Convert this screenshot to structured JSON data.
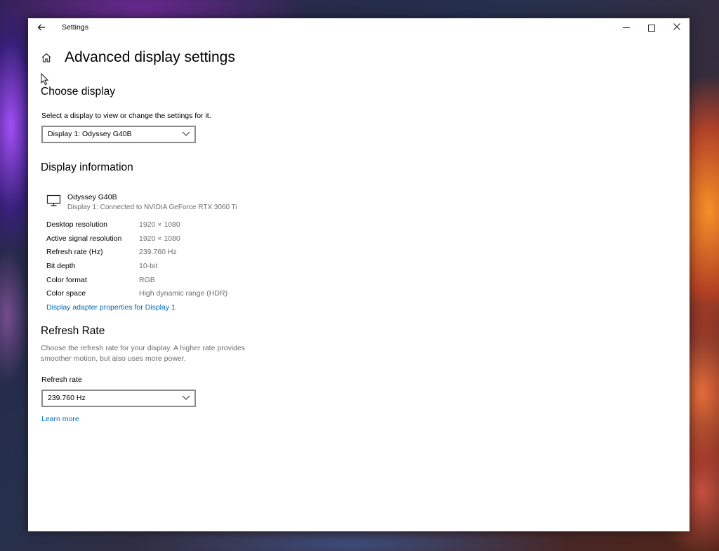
{
  "window": {
    "title": "Settings"
  },
  "page": {
    "title": "Advanced display settings"
  },
  "choose_display": {
    "heading": "Choose display",
    "instruction": "Select a display to view or change the settings for it.",
    "selected_display": "Display 1: Odyssey G40B"
  },
  "display_info": {
    "heading": "Display information",
    "monitor_name": "Odyssey G40B",
    "monitor_connection": "Display 1: Connected to NVIDIA GeForce RTX 3060 Ti",
    "rows": [
      {
        "label": "Desktop resolution",
        "value": "1920 × 1080"
      },
      {
        "label": "Active signal resolution",
        "value": "1920 × 1080"
      },
      {
        "label": "Refresh rate (Hz)",
        "value": "239.760 Hz"
      },
      {
        "label": "Bit depth",
        "value": "10-bit"
      },
      {
        "label": "Color format",
        "value": "RGB"
      },
      {
        "label": "Color space",
        "value": "High dynamic range (HDR)"
      }
    ],
    "adapter_link": "Display adapter properties for Display 1"
  },
  "refresh_rate": {
    "heading": "Refresh Rate",
    "description_line1": "Choose the refresh rate for your display. A higher rate provides",
    "description_line2": "smoother motion, but also uses more power.",
    "field_label": "Refresh rate",
    "selected_rate": "239.760 Hz",
    "learn_more": "Learn more"
  },
  "icons": {
    "back": "back-arrow-icon",
    "home": "home-icon",
    "monitor": "monitor-icon",
    "chevron": "chevron-down-icon"
  },
  "colors": {
    "link": "#0067b8",
    "muted_text": "#6d6d6d",
    "combo_border": "#8a8a8a"
  }
}
